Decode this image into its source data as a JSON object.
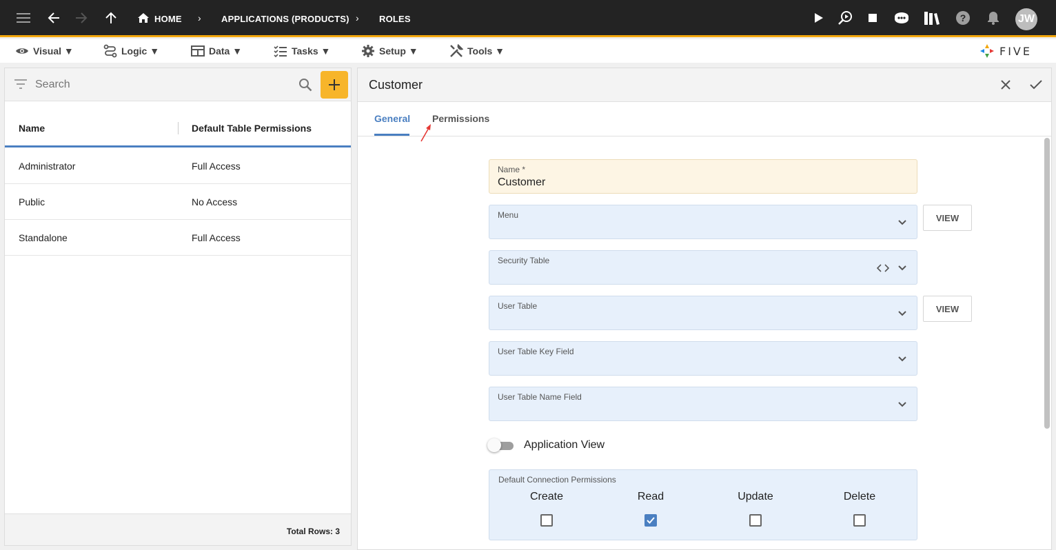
{
  "topbar": {
    "breadcrumbs": [
      "HOME",
      "APPLICATIONS (PRODUCTS)",
      "ROLES"
    ],
    "avatar_initials": "JW"
  },
  "menubar": {
    "items": [
      {
        "label": "Visual ▼",
        "icon": "eye-icon"
      },
      {
        "label": "Logic ▼",
        "icon": "logic-icon"
      },
      {
        "label": "Data ▼",
        "icon": "table-icon"
      },
      {
        "label": "Tasks ▼",
        "icon": "tasks-icon"
      },
      {
        "label": "Setup ▼",
        "icon": "gear-icon"
      },
      {
        "label": "Tools ▼",
        "icon": "tools-icon"
      }
    ],
    "logo_text": "FIVE"
  },
  "list": {
    "search_placeholder": "Search",
    "columns": [
      "Name",
      "Default Table Permissions"
    ],
    "rows": [
      {
        "name": "Administrator",
        "perm": "Full Access"
      },
      {
        "name": "Public",
        "perm": "No Access"
      },
      {
        "name": "Standalone",
        "perm": "Full Access"
      }
    ],
    "footer": "Total Rows: 3"
  },
  "form": {
    "title": "Customer",
    "tabs": [
      "General",
      "Permissions"
    ],
    "name_label": "Name *",
    "name_value": "Customer",
    "menu_label": "Menu",
    "security_table_label": "Security Table",
    "user_table_label": "User Table",
    "user_table_key_label": "User Table Key Field",
    "user_table_name_label": "User Table Name Field",
    "view_label": "VIEW",
    "app_view_label": "Application View",
    "perm_title": "Default Connection Permissions",
    "perm_cols": [
      "Create",
      "Read",
      "Update",
      "Delete"
    ],
    "perm_checked": [
      false,
      true,
      false,
      false
    ]
  },
  "colors": {
    "accent": "#f2a60c",
    "primary": "#4a7fc1",
    "add_button": "#f7b52a"
  }
}
